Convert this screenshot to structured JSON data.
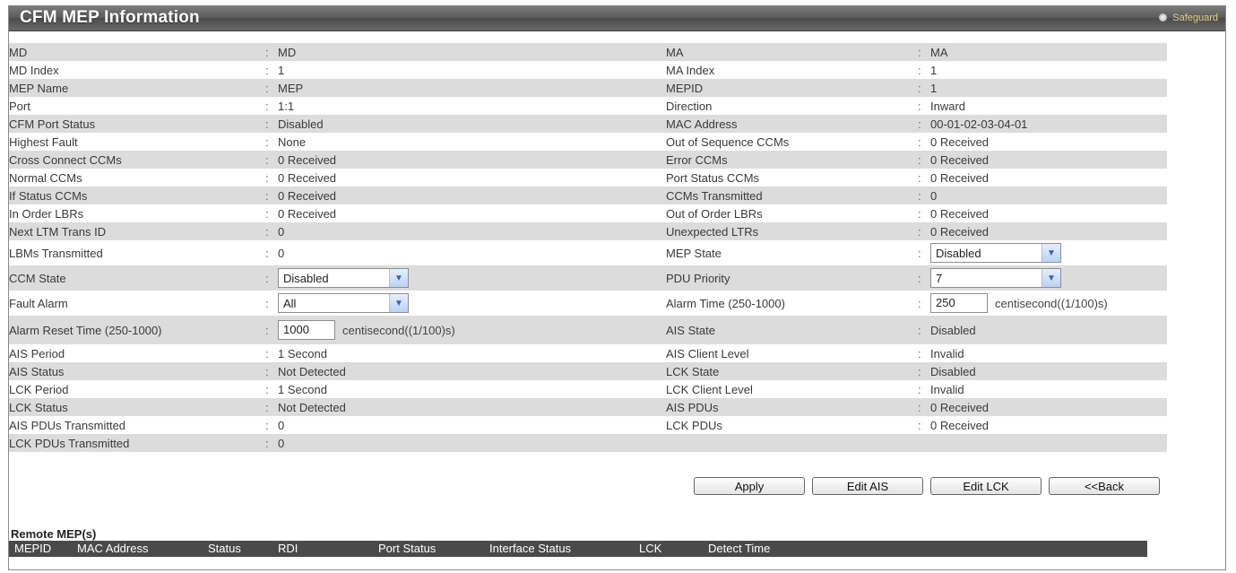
{
  "header": {
    "title": "CFM MEP Information",
    "safeguard": "Safeguard"
  },
  "rows": [
    {
      "l1": "MD",
      "v1": "MD",
      "l2": "MA",
      "v2": "MA"
    },
    {
      "l1": "MD Index",
      "v1": "1",
      "l2": "MA Index",
      "v2": "1"
    },
    {
      "l1": "MEP Name",
      "v1": "MEP",
      "l2": "MEPID",
      "v2": "1"
    },
    {
      "l1": "Port",
      "v1": "1:1",
      "l2": "Direction",
      "v2": "Inward"
    },
    {
      "l1": "CFM Port Status",
      "v1": "Disabled",
      "l2": "MAC Address",
      "v2": "00-01-02-03-04-01"
    },
    {
      "l1": "Highest Fault",
      "v1": "None",
      "l2": "Out of Sequence CCMs",
      "v2": "0 Received"
    },
    {
      "l1": "Cross Connect CCMs",
      "v1": "0 Received",
      "l2": "Error CCMs",
      "v2": "0 Received"
    },
    {
      "l1": "Normal CCMs",
      "v1": "0 Received",
      "l2": "Port Status CCMs",
      "v2": "0 Received"
    },
    {
      "l1": "If Status CCMs",
      "v1": "0 Received",
      "l2": "CCMs Transmitted",
      "v2": "0"
    },
    {
      "l1": "In Order LBRs",
      "v1": "0 Received",
      "l2": "Out of Order LBRs",
      "v2": "0 Received"
    },
    {
      "l1": "Next LTM Trans ID",
      "v1": "0",
      "l2": "Unexpected LTRs",
      "v2": "0 Received"
    },
    {
      "l1": "LBMs Transmitted",
      "v1": "0",
      "l2": "MEP State",
      "v2_select": "Disabled"
    },
    {
      "l1": "CCM State",
      "v1_select": "Disabled",
      "l2": "PDU Priority",
      "v2_select": "7"
    },
    {
      "l1": "Fault Alarm",
      "v1_select": "All",
      "l2": "Alarm Time (250-1000)",
      "v2_input": "250",
      "v2_unit": "centisecond((1/100)s)"
    },
    {
      "l1": "Alarm Reset Time (250-1000)",
      "v1_input": "1000",
      "v1_unit": "centisecond((1/100)s)",
      "l2": "AIS State",
      "v2": "Disabled"
    },
    {
      "l1": "AIS Period",
      "v1": "1 Second",
      "l2": "AIS Client Level",
      "v2": "Invalid"
    },
    {
      "l1": "AIS Status",
      "v1": "Not Detected",
      "l2": "LCK State",
      "v2": "Disabled"
    },
    {
      "l1": "LCK Period",
      "v1": "1 Second",
      "l2": "LCK Client Level",
      "v2": "Invalid"
    },
    {
      "l1": "LCK Status",
      "v1": "Not Detected",
      "l2": "AIS PDUs",
      "v2": "0 Received"
    },
    {
      "l1": "AIS PDUs Transmitted",
      "v1": "0",
      "l2": "LCK PDUs",
      "v2": "0 Received"
    },
    {
      "l1": "LCK PDUs Transmitted",
      "v1": "0",
      "l2": "",
      "v2": ""
    }
  ],
  "buttons": {
    "apply": "Apply",
    "edit_ais": "Edit AIS",
    "edit_lck": "Edit LCK",
    "back": "<<Back"
  },
  "remote": {
    "title": "Remote MEP(s)",
    "columns": [
      "MEPID",
      "MAC Address",
      "Status",
      "RDI",
      "Port Status",
      "Interface Status",
      "LCK",
      "Detect Time"
    ]
  }
}
